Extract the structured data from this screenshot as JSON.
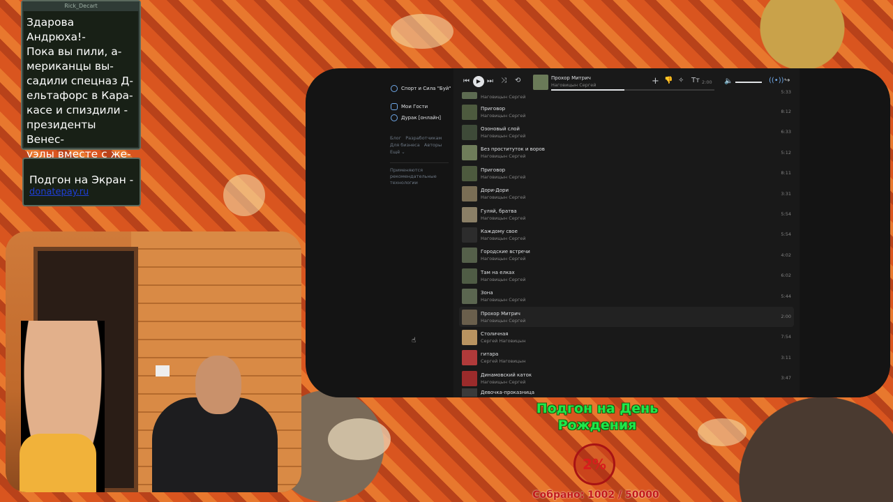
{
  "chat": {
    "author": "Rick_Decart",
    "message": "Здарова Андрюха!-\nПока вы пили, а-\nмериканцы вы-\nсадили спецназ Д-\nельтафорс в Кара-\nкасе и спиздили -\nпрезиденты Венес-\nуэлы вместе с же-\nной."
  },
  "promo": {
    "title": "Подгон на Экран -",
    "link": "donatepay.ru"
  },
  "vk": {
    "left_nav": [
      {
        "label": "Спорт и Сила \"Буй\""
      },
      {
        "label": "Мои Гости"
      },
      {
        "label": "Дурак [онлайн]"
      }
    ],
    "footer_links": [
      "Блог",
      "Разработчикам",
      "Для бизнеса",
      "Авторы",
      "Ещё ⌄"
    ],
    "recommend_note": "Применяются рекомендательные технологии",
    "player": {
      "title": "Прохор Митрич",
      "artist": "Наговицын Сергей",
      "time": "2:00",
      "progress": 0.45
    },
    "tracks": [
      {
        "title": "",
        "artist": "Наговицын Сергей",
        "duration": "5:33",
        "active": false
      },
      {
        "title": "Приговор",
        "artist": "Наговицын Сергей",
        "duration": "8:12",
        "active": false
      },
      {
        "title": "Озоновый слой",
        "artist": "Наговицын Сергей",
        "duration": "6:33",
        "active": false
      },
      {
        "title": "Без проституток и воров",
        "artist": "Наговицын Сергей",
        "duration": "5:12",
        "active": false
      },
      {
        "title": "Приговор",
        "artist": "Наговицын Сергей",
        "duration": "8:11",
        "active": false
      },
      {
        "title": "Дори-Дори",
        "artist": "Наговицын Сергей",
        "duration": "3:31",
        "active": false
      },
      {
        "title": "Гуляй, братва",
        "artist": "Наговицын Сергей",
        "duration": "5:54",
        "active": false
      },
      {
        "title": "Каждому свое",
        "artist": "Наговицын Сергей",
        "duration": "5:54",
        "active": false
      },
      {
        "title": "Городские встречи",
        "artist": "Наговицын Сергей",
        "duration": "4:02",
        "active": false
      },
      {
        "title": "Там на елках",
        "artist": "Наговицын Сергей",
        "duration": "6:02",
        "active": false
      },
      {
        "title": "Зона",
        "artist": "Наговицын Сергей",
        "duration": "5:44",
        "active": false
      },
      {
        "title": "Прохор Митрич",
        "artist": "Наговицын Сергей",
        "duration": "2:00",
        "active": true
      },
      {
        "title": "Столичная",
        "artist": "Сергей Наговицын",
        "duration": "7:54",
        "active": false
      },
      {
        "title": "гитара",
        "artist": "Сергей Наговицын",
        "duration": "3:11",
        "active": false
      },
      {
        "title": "Динамовский каток",
        "artist": "Наговицын Сергей",
        "duration": "3:47",
        "active": false
      },
      {
        "title": "Девочка-проказница",
        "artist": "",
        "duration": "",
        "active": false
      }
    ]
  },
  "birthday": {
    "title": "Подгон на День Рождения",
    "percent": "2%",
    "collected": "Собрано: 1002 / 50000"
  },
  "colors": {
    "accent_green": "#1ee84a",
    "accent_red": "#c31a1a",
    "vk_bg": "#191919",
    "vk_link": "#71aaeb"
  }
}
